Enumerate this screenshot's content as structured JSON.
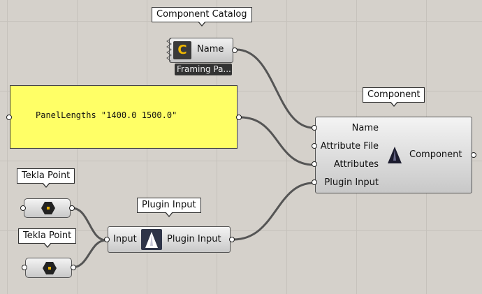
{
  "tooltips": {
    "catalog": "Component Catalog",
    "component": "Component",
    "tekla_point_1": "Tekla Point",
    "tekla_point_2": "Tekla Point",
    "plugin_input": "Plugin Input"
  },
  "catalog_node": {
    "icon_letter": "C",
    "output_label": "Name",
    "caption": "Framing Pa..."
  },
  "panel": {
    "text": "PanelLengths \"1400.0 1500.0\"",
    "background": "#ffff66"
  },
  "component_node": {
    "inputs": [
      "Name",
      "Attribute File",
      "Attributes",
      "Plugin Input"
    ],
    "output_label": "Component",
    "icon": "tekla-triangle-icon"
  },
  "plugin_node": {
    "input_label": "Input",
    "output_label": "Plugin Input",
    "icon": "tekla-triangle-icon"
  },
  "colors": {
    "canvas": "#d5d1cb",
    "wire": "#555555",
    "hex": "#222222",
    "accent": "#e8b000"
  }
}
